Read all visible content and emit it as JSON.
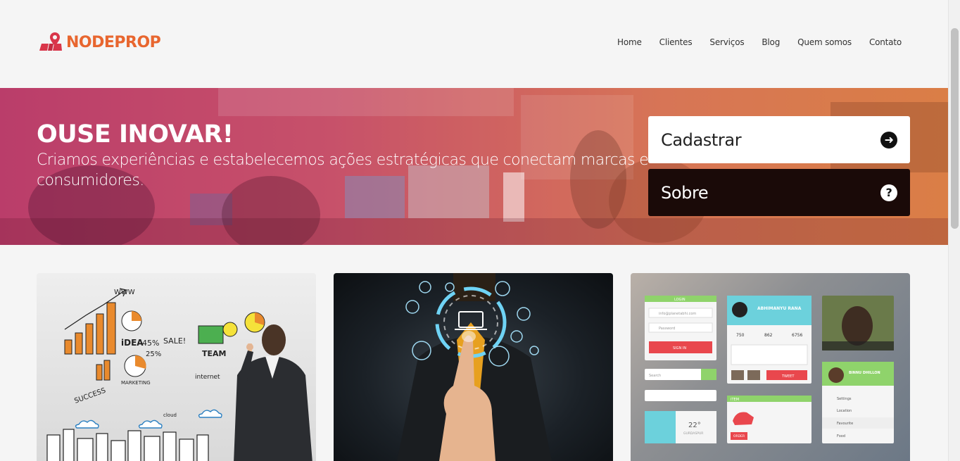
{
  "brand": {
    "name": "NODEPROP",
    "color": "#e8662f",
    "mark_color": "#d9364a"
  },
  "nav": [
    {
      "label": "Home"
    },
    {
      "label": "Clientes"
    },
    {
      "label": "Serviços"
    },
    {
      "label": "Blog"
    },
    {
      "label": "Quem somos"
    },
    {
      "label": "Contato"
    }
  ],
  "hero": {
    "title": "OUSE INOVAR!",
    "subtitle": "Criamos experiências e estabelecemos ações estratégicas que conectam marcas e consumidores."
  },
  "cta": {
    "primary": {
      "label": "Cadastrar",
      "icon": "arrow-circle-right-icon"
    },
    "secondary": {
      "label": "Sobre",
      "icon": "question-circle-icon"
    }
  },
  "cards": [
    {
      "image": "business-sketch-whiteboard"
    },
    {
      "image": "touch-technology-icons"
    },
    {
      "image": "ui-kit-widgets"
    }
  ],
  "ui_kit": {
    "login_title": "LOGIN",
    "email_placeholder": "info@planetabhi.com",
    "password_placeholder": "Password",
    "sign_in": "SIGN IN",
    "profile_name": "ABHIMANYU RANA",
    "stats": [
      "750",
      "862",
      "6756"
    ],
    "tweet": "TWEET",
    "search": "Search",
    "user2": "BINNU DHILLON",
    "menu": [
      "Settings",
      "Location",
      "Favourite",
      "Food"
    ],
    "temp": "22°",
    "city": "GURDASPUR",
    "item": "ITEM",
    "order": "ORDER"
  },
  "sketch": {
    "www": "WWW",
    "idea": "iDEA",
    "pct": "45%",
    "sale": "SALE!",
    "team": "TEAM",
    "internet": "internet",
    "marketing": "MARKETING",
    "success": "SUCCESS",
    "cloud": "cloud",
    "pct2": "25%"
  },
  "colors": {
    "accent": "#e8662f",
    "hero_left": "#c2406f",
    "hero_right": "#e38449",
    "dark_button": "#1a0a08"
  }
}
